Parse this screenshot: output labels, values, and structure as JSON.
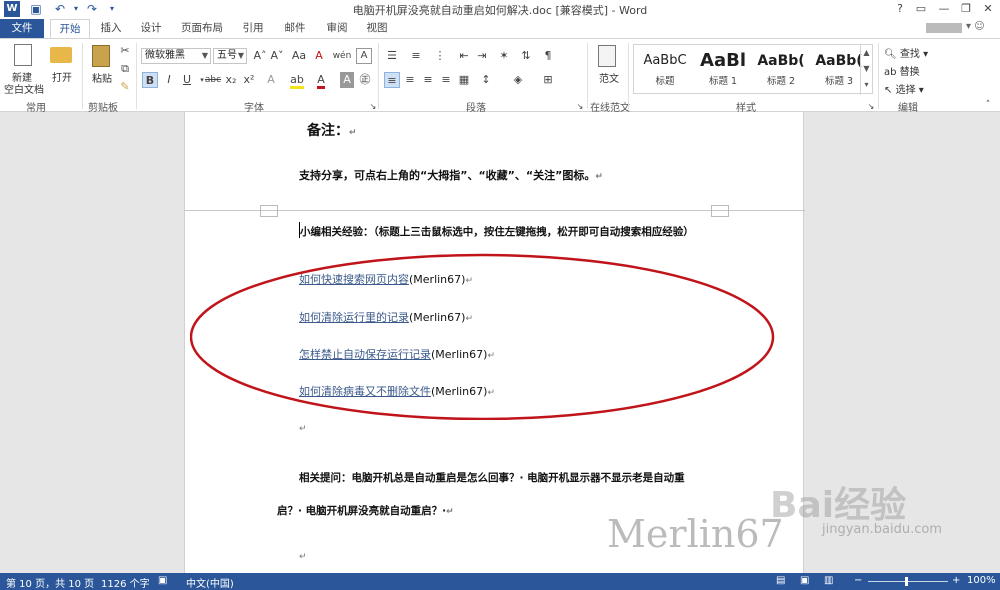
{
  "title_bar": {
    "title": "电脑开机屏没亮就自动重启如何解决.doc [兼容模式] - Word",
    "help": "?",
    "user": "▓▓▓▓"
  },
  "tabs": [
    "文件",
    "开始",
    "插入",
    "设计",
    "页面布局",
    "引用",
    "邮件",
    "审阅",
    "视图"
  ],
  "ribbon": {
    "common": {
      "new_label_1": "新建",
      "new_label_2": "空白文档",
      "open_label": "打开",
      "group": "常用"
    },
    "clipboard": {
      "paste_label": "粘贴",
      "group": "剪贴板"
    },
    "font": {
      "name": "微软雅黑",
      "size": "五号",
      "grow": "A˄",
      "shrink": "A˅",
      "case": "Aa",
      "clear": "A",
      "wen": "wén",
      "bold": "B",
      "italic": "I",
      "underline": "U",
      "strike": "abc",
      "sub": "x₂",
      "sup": "x²",
      "group": "字体"
    },
    "paragraph": {
      "group": "段落"
    },
    "online": {
      "label": "范文",
      "group": "在线范文"
    },
    "styles": {
      "items": [
        {
          "sample": "AaBbC",
          "name": "标题"
        },
        {
          "sample": "AaBl",
          "name": "标题 1"
        },
        {
          "sample": "AaBb(",
          "name": "标题 2"
        },
        {
          "sample": "AaBb(",
          "name": "标题 3"
        }
      ],
      "group": "样式"
    },
    "editing": {
      "find": "查找",
      "replace": "替换",
      "select": "选择",
      "group": "编辑"
    }
  },
  "document": {
    "note_title": "备注：",
    "support_text": "支持分享，可点右上角的“大拇指”、“收藏”、“关注”图标。",
    "related_intro": "小编相关经验：（标题上三击鼠标选中，按住左键拖拽，松开即可自动搜索相应经验）",
    "links": [
      {
        "text": "如何快速搜索网页内容",
        "author": "(Merlin67)"
      },
      {
        "text": "如何清除运行里的记录",
        "author": "(Merlin67)"
      },
      {
        "text": "怎样禁止自动保存运行记录",
        "author": "(Merlin67)"
      },
      {
        "text": "如何清除病毒又不删除文件",
        "author": "(Merlin67)"
      }
    ],
    "question_line_1": "相关提问：电脑开机总是自动重启是怎么回事？· 电脑开机显示器不显示老是自动重",
    "question_line_2": "启？· 电脑开机屏没亮就自动重启？·",
    "watermark_author": "Merlin67",
    "watermark_site": "Bai经验",
    "watermark_url": "jingyan.baidu.com"
  },
  "status_bar": {
    "page": "第 10 页，共 10 页",
    "words": "1126 个字",
    "lang": "中文(中国)",
    "zoom": "100%"
  },
  "colors": {
    "accent": "#2b579a",
    "annotation": "#c0141a"
  }
}
